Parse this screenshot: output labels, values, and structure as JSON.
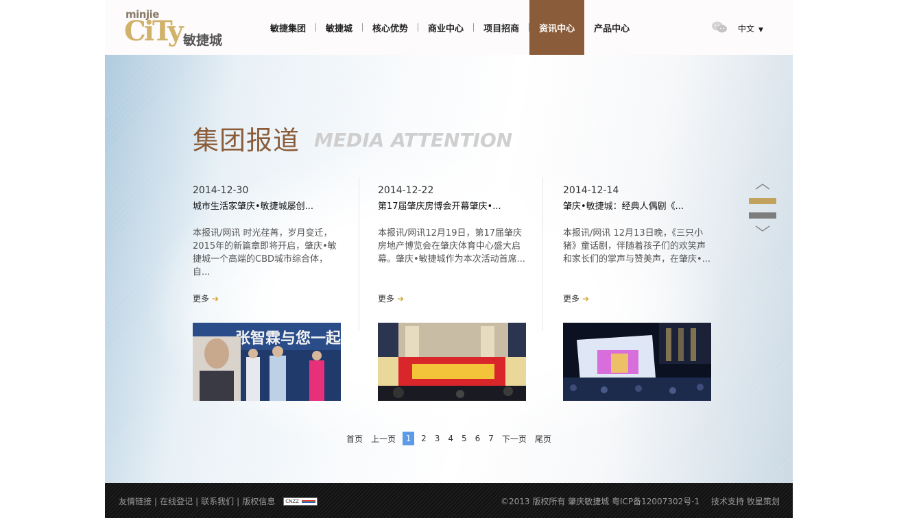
{
  "header": {
    "logo_small": "minjie",
    "logo_big": "CiTy",
    "logo_cn": "敏捷城",
    "nav": [
      "敏捷集团",
      "敏捷城",
      "核心优势",
      "商业中心",
      "项目招商",
      "资讯中心",
      "产品中心"
    ],
    "active_nav": "资讯中心",
    "language": "中文",
    "wechat_icon": "wechat-icon"
  },
  "section": {
    "title_cn": "集团报道",
    "title_en": "MEDIA ATTENTION"
  },
  "articles": [
    {
      "date": "2014-12-30",
      "headline": "城市生活家肇庆•敏捷城屡创...",
      "summary": "本报讯/网讯 时光荏苒，岁月变迁，2015年的新篇章即将开启，肇庆•敏捷城一个高端的CBD城市综合体，自...",
      "more": "更多",
      "image": "photo-stage-event"
    },
    {
      "date": "2014-12-22",
      "headline": "第17届肇庆房博会开幕肇庆•...",
      "summary": "本报讯/网讯12月19日，第17届肇庆房地产博览会在肇庆体育中心盛大启幕。肇庆•敏捷城作为本次活动首席...",
      "more": "更多",
      "image": "photo-expo-opening"
    },
    {
      "date": "2014-12-14",
      "headline": "肇庆•敏捷城：经典人偶剧《...",
      "summary": "本报讯/网讯 12月13日晚，《三只小猪》童话剧，伴随着孩子们的欢笑声和家长们的掌声与赞美声，在肇庆•...",
      "more": "更多",
      "image": "photo-night-show"
    }
  ],
  "pager": {
    "first": "首页",
    "prev": "上一页",
    "pages": [
      "1",
      "2",
      "3",
      "4",
      "5",
      "6",
      "7"
    ],
    "current": "1",
    "next": "下一页",
    "last": "尾页"
  },
  "footer": {
    "links": [
      "友情链接",
      "在线登记",
      "联系我们",
      "版权信息"
    ],
    "badge": "CNZZ",
    "copyright": "©2013 版权所有 肇庆敏捷城 粤ICP备12007302号-1",
    "support": "技术支持 牧星策划"
  },
  "colors": {
    "accent_brown": "#8b5c39",
    "logo_gold": "#d1b26a",
    "pager_blue": "#5b9be8",
    "footer_bg": "#151515"
  }
}
